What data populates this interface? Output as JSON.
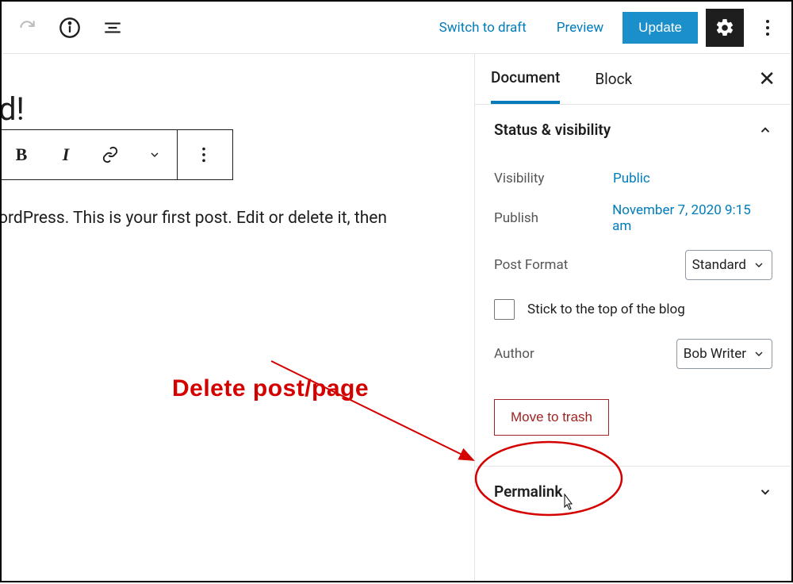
{
  "toolbar": {
    "switch_to_draft": "Switch to draft",
    "preview": "Preview",
    "update": "Update"
  },
  "editor": {
    "title_fragment": "d!",
    "paragraph_fragment": "ordPress. This is your first post. Edit or delete it, then"
  },
  "sidebar": {
    "tabs": {
      "document": "Document",
      "block": "Block"
    },
    "panels": {
      "status": {
        "title": "Status & visibility",
        "visibility_label": "Visibility",
        "visibility_value": "Public",
        "publish_label": "Publish",
        "publish_value": "November 7, 2020 9:15 am",
        "post_format_label": "Post Format",
        "post_format_value": "Standard",
        "stick_label": "Stick to the top of the blog",
        "author_label": "Author",
        "author_value": "Bob Writer",
        "move_to_trash": "Move to trash"
      },
      "permalink": {
        "title": "Permalink"
      }
    }
  },
  "annotation": {
    "label": "Delete post/page"
  }
}
